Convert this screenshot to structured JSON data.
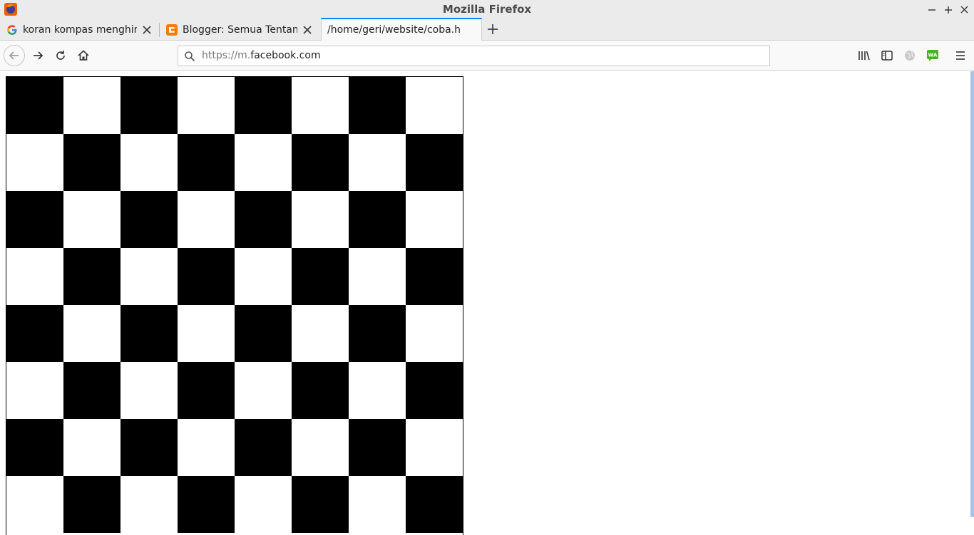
{
  "window": {
    "title": "Mozilla Firefox",
    "minimize_icon": "minimize-icon",
    "maximize_icon": "maximize-icon",
    "close_icon": "close-icon"
  },
  "tabs": [
    {
      "label": "koran kompas menghina",
      "favicon": "google-favicon",
      "active": false
    },
    {
      "label": "Blogger: Semua Tentang",
      "favicon": "blogger-favicon",
      "active": false
    },
    {
      "label": "/home/geri/website/coba.h",
      "favicon": "",
      "active": true
    }
  ],
  "navbar": {
    "url_prefix": "https://m.",
    "url_domain": "facebook.com"
  },
  "board": {
    "rows": 8,
    "cols": 8,
    "top_left": "black",
    "dark_color": "#000000",
    "light_color": "#ffffff"
  },
  "colors": {
    "accent": "#0a84ff",
    "chrome": "#ebebeb",
    "blogger": "#f57d00",
    "wa_green": "#4caf28"
  }
}
